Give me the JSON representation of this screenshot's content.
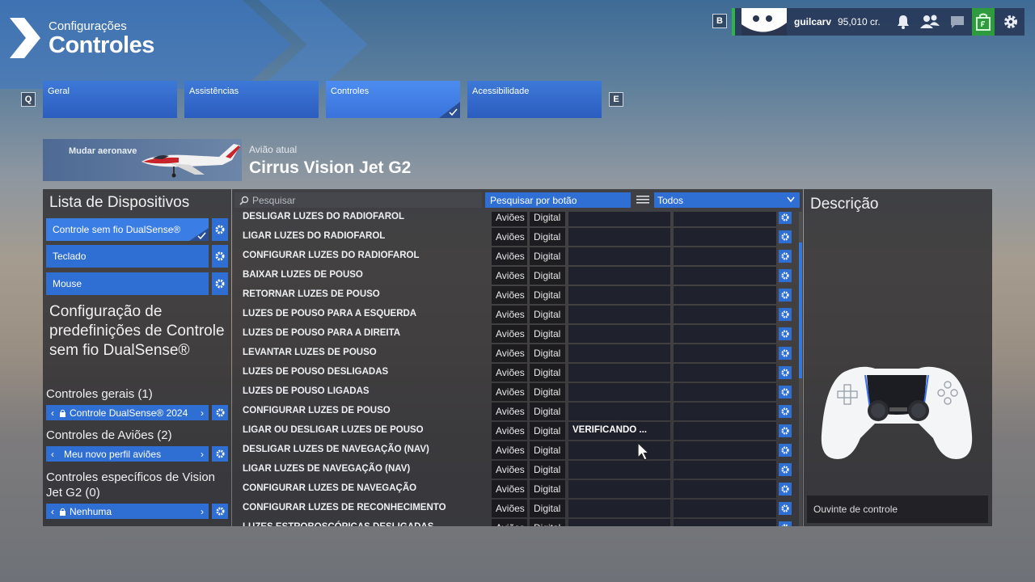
{
  "header": {
    "subtitle": "Configurações",
    "title": "Controles"
  },
  "topbar": {
    "key_b": "B",
    "username": "guilcarv",
    "credits": "95,010 cr."
  },
  "tabs": {
    "key_left": "Q",
    "key_right": "E",
    "items": [
      {
        "label": "Geral"
      },
      {
        "label": "Assistências"
      },
      {
        "label": "Controles"
      },
      {
        "label": "Acessibilidade"
      }
    ]
  },
  "aircraft": {
    "change_label": "Mudar aeronave",
    "current_label": "Avião atual",
    "current_name": "Cirrus Vision Jet G2"
  },
  "devices": {
    "header": "Lista de Dispositivos",
    "items": [
      {
        "label": "Controle sem fio DualSense®"
      },
      {
        "label": "Teclado"
      },
      {
        "label": "Mouse"
      }
    ]
  },
  "presets": {
    "header": "Configuração de predefinições de Controle sem fio DualSense®",
    "general": {
      "label": "Controles gerais (1)",
      "value": "Controle DualSense® 2024"
    },
    "planes": {
      "label": "Controles de Aviões (2)",
      "value": "Meu novo perfil aviões"
    },
    "specific": {
      "label": "Controles específicos de Vision Jet G2 (0)",
      "value": "Nenhuma"
    }
  },
  "toolbar": {
    "search_placeholder": "Pesquisar",
    "search_by_button": "Pesquisar por botão",
    "filter": "Todos"
  },
  "bindings": [
    {
      "name": "DESLIGAR LUZES DO RADIOFAROL",
      "category": "Aviões",
      "type": "Digital",
      "slot1": "",
      "slot2": ""
    },
    {
      "name": "LIGAR LUZES DO RADIOFAROL",
      "category": "Aviões",
      "type": "Digital",
      "slot1": "",
      "slot2": ""
    },
    {
      "name": "CONFIGURAR LUZES DO RADIOFAROL",
      "category": "Aviões",
      "type": "Digital",
      "slot1": "",
      "slot2": ""
    },
    {
      "name": "BAIXAR LUZES DE POUSO",
      "category": "Aviões",
      "type": "Digital",
      "slot1": "",
      "slot2": ""
    },
    {
      "name": "RETORNAR LUZES DE POUSO",
      "category": "Aviões",
      "type": "Digital",
      "slot1": "",
      "slot2": ""
    },
    {
      "name": "LUZES DE POUSO PARA A ESQUERDA",
      "category": "Aviões",
      "type": "Digital",
      "slot1": "",
      "slot2": ""
    },
    {
      "name": "LUZES DE POUSO PARA A DIREITA",
      "category": "Aviões",
      "type": "Digital",
      "slot1": "",
      "slot2": ""
    },
    {
      "name": "LEVANTAR LUZES DE POUSO",
      "category": "Aviões",
      "type": "Digital",
      "slot1": "",
      "slot2": ""
    },
    {
      "name": "LUZES DE POUSO DESLIGADAS",
      "category": "Aviões",
      "type": "Digital",
      "slot1": "",
      "slot2": ""
    },
    {
      "name": "LUZES DE POUSO LIGADAS",
      "category": "Aviões",
      "type": "Digital",
      "slot1": "",
      "slot2": ""
    },
    {
      "name": "CONFIGURAR LUZES DE POUSO",
      "category": "Aviões",
      "type": "Digital",
      "slot1": "",
      "slot2": ""
    },
    {
      "name": "LIGAR OU DESLIGAR LUZES DE POUSO",
      "category": "Aviões",
      "type": "Digital",
      "slot1": "VERIFICANDO ...",
      "slot2": ""
    },
    {
      "name": "DESLIGAR LUZES DE NAVEGAÇÃO (NAV)",
      "category": "Aviões",
      "type": "Digital",
      "slot1": "",
      "slot2": ""
    },
    {
      "name": "LIGAR LUZES DE NAVEGAÇÃO (NAV)",
      "category": "Aviões",
      "type": "Digital",
      "slot1": "",
      "slot2": ""
    },
    {
      "name": "CONFIGURAR LUZES DE NAVEGAÇÃO",
      "category": "Aviões",
      "type": "Digital",
      "slot1": "",
      "slot2": ""
    },
    {
      "name": "CONFIGURAR LUZES DE RECONHECIMENTO",
      "category": "Aviões",
      "type": "Digital",
      "slot1": "",
      "slot2": ""
    },
    {
      "name": "LUZES ESTROBOSCÓPICAS DESLIGADAS",
      "category": "Aviões",
      "type": "Digital",
      "slot1": "",
      "slot2": ""
    }
  ],
  "description": {
    "header": "Descrição",
    "listener": "Ouvinte de controle"
  }
}
